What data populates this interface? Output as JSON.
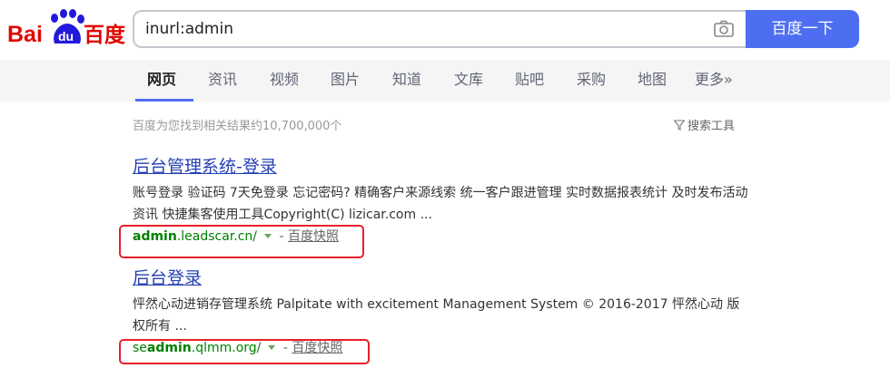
{
  "brand": {
    "logo_text_left": "Bai",
    "logo_text_paw": "du",
    "logo_text_right": "百度",
    "colors": {
      "red": "#e10601",
      "blue": "#2319dc"
    }
  },
  "search": {
    "query": "inurl:admin",
    "button_label": "百度一下"
  },
  "nav": {
    "items": [
      {
        "label": "网页",
        "active": true
      },
      {
        "label": "资讯"
      },
      {
        "label": "视频"
      },
      {
        "label": "图片"
      },
      {
        "label": "知道"
      },
      {
        "label": "文库"
      },
      {
        "label": "贴吧"
      },
      {
        "label": "采购"
      },
      {
        "label": "地图"
      },
      {
        "label": "更多»"
      }
    ]
  },
  "stats": {
    "count_text": "百度为您找到相关结果约10,700,000个",
    "tools_label": "搜索工具"
  },
  "results": [
    {
      "title": "后台管理系统-登录",
      "description": "账号登录 验证码 7天免登录 忘记密码? 精确客户来源线索 统一客户跟进管理 实时数据报表统计 及时发布活动资讯 快捷集客使用工具Copyright(C) lizicar.com ...",
      "url_prefix": "",
      "url_bold": "admin",
      "url_rest": ".leadscar.cn/",
      "separator": " - ",
      "snapshot_label": "百度快照"
    },
    {
      "title": "后台登录",
      "description": "怦然心动进销存管理系统 Palpitate with excitement Management System © 2016-2017 怦然心动 版权所有 ...",
      "url_prefix": "se",
      "url_bold": "admin",
      "url_rest": ".qlmm.org/",
      "separator": " - ",
      "snapshot_label": "百度快照"
    }
  ],
  "colors": {
    "accent": "#4e6ef2",
    "link": "#2440b3",
    "url_green": "#008000",
    "highlight_red": "#e8202a"
  }
}
